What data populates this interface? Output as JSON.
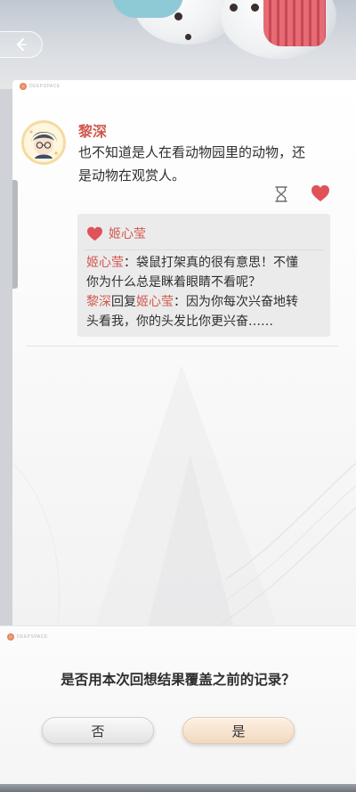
{
  "card": {
    "brand": "DEEPSPACE",
    "author": "黎深",
    "post_line1": "也不知道是人在看动物园里的动物，还",
    "post_line2": "是动物在观赏人。",
    "liker": "姬心莹",
    "comment1_name": "姬心莹",
    "comment1_line1": "：袋鼠打架真的很有意思！不懂",
    "comment1_line2": "你为什么总是眯着眼睛不看呢？",
    "reply_author": "黎深",
    "reply_word": "回复",
    "reply_target": "姬心莹",
    "reply_line1": "：因为你每次兴奋地转",
    "reply_line2": "头看我，你的头发比你更兴奋……"
  },
  "dialog": {
    "brand": "DEEPSPACE",
    "question": "是否用本次回想结果覆盖之前的记录？",
    "no_label": "否",
    "yes_label": "是"
  },
  "colors": {
    "name_red": "#d0584c",
    "heart_red": "#e0525a",
    "yes_button": "#f2d9c0"
  },
  "icons": [
    "back-arrow-icon",
    "hourglass-icon",
    "heart-icon",
    "deepspace-logo-icon"
  ]
}
